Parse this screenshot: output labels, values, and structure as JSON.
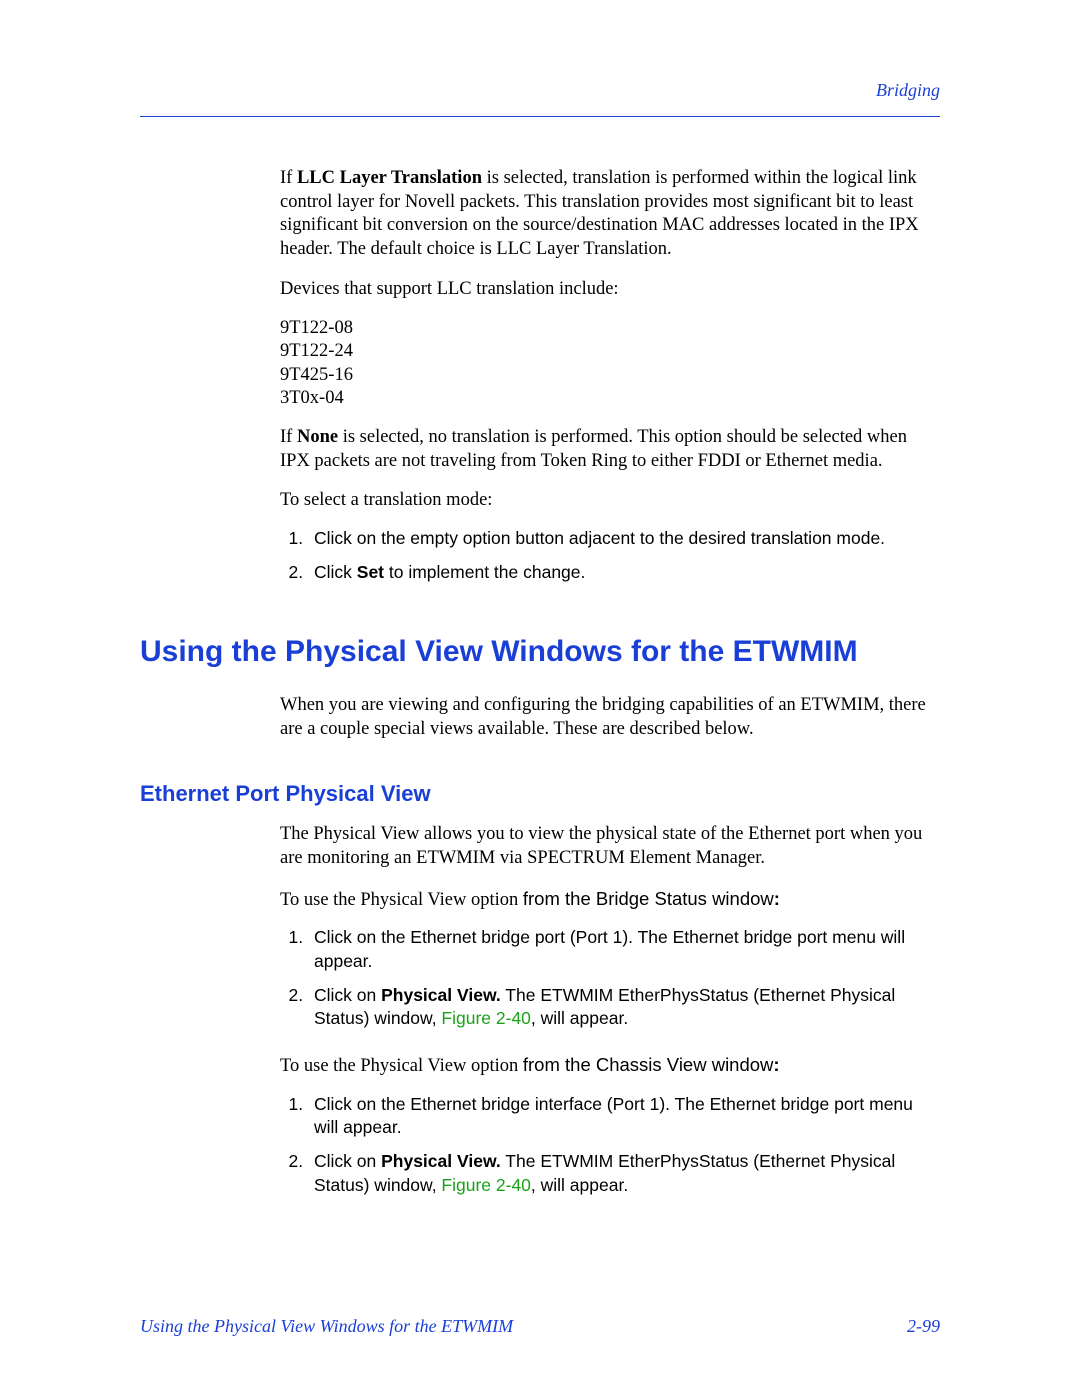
{
  "header": {
    "right": "Bridging"
  },
  "p1_prefix": "If ",
  "p1_bold": "LLC Layer Translation",
  "p1_rest": " is selected, translation is performed within the logical link control layer for Novell packets. This translation provides most significant bit to least significant bit conversion on the source/destination MAC addresses located in the IPX header. The default choice is LLC Layer Translation.",
  "p2": "Devices that support LLC translation include:",
  "devices": [
    "9T122-08",
    "9T122-24",
    "9T425-16",
    "3T0x-04"
  ],
  "p3_prefix": "If ",
  "p3_bold": "None",
  "p3_rest": " is selected, no translation is performed. This option should be selected when IPX packets are not traveling from Token Ring to either FDDI or Ethernet media.",
  "p4": "To select a translation mode:",
  "steps_a": {
    "s1": "Click on the empty option button adjacent to the desired translation mode.",
    "s2_a": "Click ",
    "s2_b": "Set",
    "s2_c": " to implement the change."
  },
  "h1": "Using the Physical View Windows for the ETWMIM",
  "p5": "When you are viewing and configuring the bridging capabilities of an ETWMIM, there are a couple special views available. These are described below.",
  "h2": "Ethernet Port Physical View",
  "p6": "The Physical View allows you to view the physical state of the Ethernet port when you are monitoring an ETWMIM via SPECTRUM Element Manager.",
  "p7_a": "To use the Physical View option ",
  "p7_b": "from the Bridge Status window",
  "p7_c": ":",
  "steps_b": {
    "s1": "Click on the Ethernet bridge port (Port 1). The Ethernet bridge port menu will appear.",
    "s2_a": "Click on ",
    "s2_b": "Physical View.",
    "s2_c": " The ETWMIM EtherPhysStatus (Ethernet Physical Status) window, ",
    "s2_link": "Figure 2-40",
    "s2_d": ", will appear."
  },
  "p8_a": "To use the Physical View option ",
  "p8_b": "from the Chassis View window",
  "p8_c": ":",
  "steps_c": {
    "s1": "Click on the Ethernet bridge interface (Port 1). The Ethernet bridge port menu will appear.",
    "s2_a": "Click on ",
    "s2_b": "Physical View.",
    "s2_c": " The ETWMIM EtherPhysStatus (Ethernet Physical Status) window, ",
    "s2_link": "Figure 2-40",
    "s2_d": ", will appear."
  },
  "footer": {
    "left": "Using the Physical View Windows for the ETWMIM",
    "right": "2-99"
  }
}
